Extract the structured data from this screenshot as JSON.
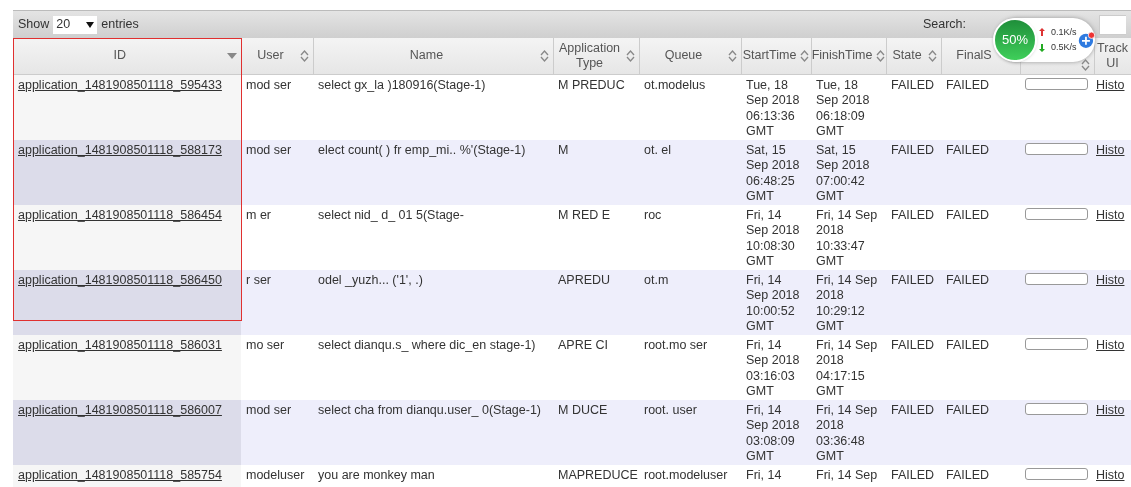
{
  "toolbar": {
    "show_label": "Show",
    "page_size": "20",
    "entries_label": "entries",
    "search_label": "Search:"
  },
  "columns": [
    {
      "label": "ID",
      "kind": "sorted"
    },
    {
      "label": "User",
      "kind": "sortable"
    },
    {
      "label": "Name",
      "kind": "sortable"
    },
    {
      "label": "Application Type",
      "kind": "sortable"
    },
    {
      "label": "Queue",
      "kind": "sortable"
    },
    {
      "label": "StartTime",
      "kind": "sortable"
    },
    {
      "label": "FinishTime",
      "kind": "sortable"
    },
    {
      "label": "State",
      "kind": "sortable"
    },
    {
      "label": "FinalS",
      "kind": "sortable"
    },
    {
      "kind": "sortable"
    },
    {
      "label": "Track UI",
      "kind": "plain"
    }
  ],
  "rows": [
    {
      "id": "application_1481908501118_595433",
      "user": "mod ser",
      "name": "select gx_la )180916(Stage-1)",
      "type": "M PREDUC",
      "queue": "ot.modelus",
      "start": "Tue, 18 Sep 2018 06:13:36 GMT",
      "finish": "Tue, 18 Sep 2018 06:18:09 GMT",
      "state": "FAILED",
      "final": "FAILED",
      "level": 0,
      "tracking": "Histo"
    },
    {
      "id": "application_1481908501118_588173",
      "user": "mod ser",
      "name": "elect count( ) fr emp_mi.. %'(Stage-1)",
      "type": "M",
      "queue": "ot. el",
      "start": "Sat, 15 Sep 2018 06:48:25 GMT",
      "finish": "Sat, 15 Sep 2018 07:00:42 GMT",
      "state": "FAILED",
      "final": "FAILED",
      "level": 0,
      "tracking": "Histo"
    },
    {
      "id": "application_1481908501118_586454",
      "user": "m er",
      "name": "select nid_ d_ 01 5(Stage-",
      "type": "M RED E",
      "queue": "roc",
      "start": "Fri, 14 Sep 2018 10:08:30 GMT",
      "finish": "Fri, 14 Sep 2018 10:33:47 GMT",
      "state": "FAILED",
      "final": "FAILED",
      "level": 0,
      "tracking": "Histo"
    },
    {
      "id": "application_1481908501118_586450",
      "user": "r ser",
      "name": "odel _yuzh... ('1', .)",
      "type": "APREDU",
      "queue": "ot.m",
      "start": "Fri, 14 Sep 2018 10:00:52 GMT",
      "finish": "Fri, 14 Sep 2018 10:29:12 GMT",
      "state": "FAILED",
      "final": "FAILED",
      "level": 0,
      "tracking": "Histo"
    },
    {
      "id": "application_1481908501118_586031",
      "user": "mo ser",
      "name": "select dianqu.s_ where dic_en stage-1)",
      "type": "APRE CI",
      "queue": "root.mo ser",
      "start": "Fri, 14 Sep 2018 03:16:03 GMT",
      "finish": "Fri, 14 Sep 2018 04:17:15 GMT",
      "state": "FAILED",
      "final": "FAILED",
      "level": 0,
      "tracking": "Histo"
    },
    {
      "id": "application_1481908501118_586007",
      "user": "mod ser",
      "name": "select cha from dianqu.user_ 0(Stage-1)",
      "type": "M DUCE",
      "queue": "root. user",
      "start": "Fri, 14 Sep 2018 03:08:09 GMT",
      "finish": "Fri, 14 Sep 2018 03:36:48 GMT",
      "state": "FAILED",
      "final": "FAILED",
      "level": 0,
      "tracking": "Histo"
    },
    {
      "id": "application_1481908501118_585754",
      "user": "modeluser",
      "name": "you are monkey man",
      "type": "MAPREDUCE",
      "queue": "root.modeluser",
      "start": "Fri, 14",
      "finish": "Fri, 14 Sep",
      "state": "FAILED",
      "final": "FAILED",
      "level": 0,
      "tracking": "Histo"
    }
  ],
  "monitor": {
    "percent": "50%",
    "upload": "0.1K/s",
    "download": "0.5K/s"
  }
}
